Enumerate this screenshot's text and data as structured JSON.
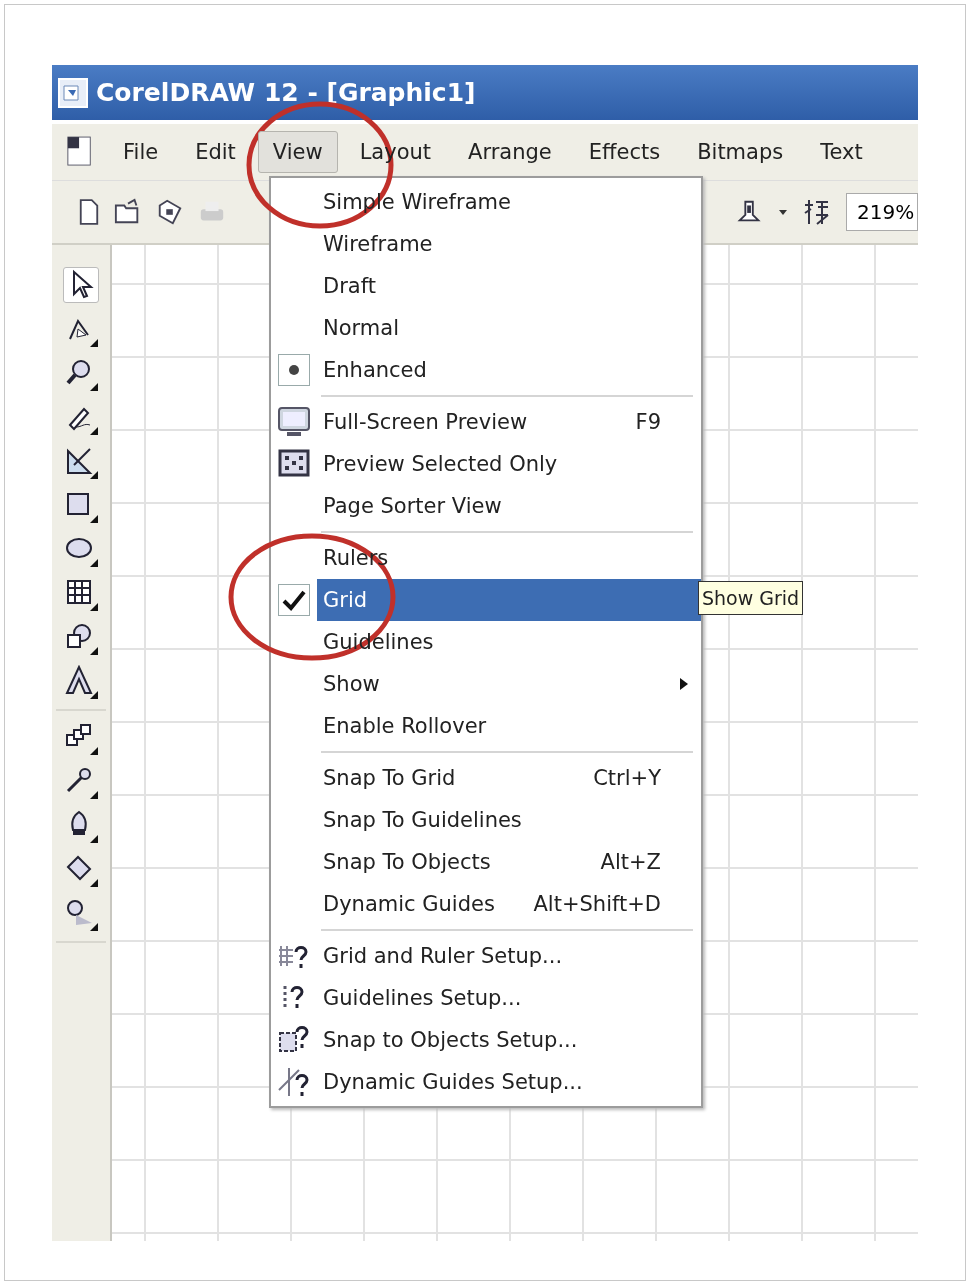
{
  "window": {
    "title": "CorelDRAW 12 - [Graphic1]"
  },
  "menu_bar": [
    {
      "label": "File",
      "selected": false
    },
    {
      "label": "Edit",
      "selected": false
    },
    {
      "label": "View",
      "selected": true
    },
    {
      "label": "Layout",
      "selected": false
    },
    {
      "label": "Arrange",
      "selected": false
    },
    {
      "label": "Effects",
      "selected": false
    },
    {
      "label": "Bitmaps",
      "selected": false
    },
    {
      "label": "Text",
      "selected": false
    }
  ],
  "toolbar": {
    "zoom": "219%"
  },
  "view_menu": [
    {
      "kind": "radio",
      "label": "Simple Wireframe",
      "checked": false,
      "selected": false
    },
    {
      "kind": "radio",
      "label": "Wireframe",
      "checked": false,
      "selected": false
    },
    {
      "kind": "radio",
      "label": "Draft",
      "checked": false,
      "selected": false
    },
    {
      "kind": "radio",
      "label": "Normal",
      "checked": false,
      "selected": false
    },
    {
      "kind": "radio",
      "label": "Enhanced",
      "checked": true,
      "selected": false
    },
    {
      "kind": "separator"
    },
    {
      "kind": "command",
      "label": "Full-Screen Preview",
      "shortcut": "F9",
      "selected": false
    },
    {
      "kind": "command",
      "label": "Preview Selected Only",
      "selected": false
    },
    {
      "kind": "command",
      "label": "Page Sorter View",
      "selected": false
    },
    {
      "kind": "separator"
    },
    {
      "kind": "check",
      "label": "Rulers",
      "checked": false,
      "selected": false
    },
    {
      "kind": "check",
      "label": "Grid",
      "checked": true,
      "selected": true
    },
    {
      "kind": "check",
      "label": "Guidelines",
      "checked": false,
      "selected": false
    },
    {
      "kind": "submenu",
      "label": "Show",
      "selected": false
    },
    {
      "kind": "check",
      "label": "Enable Rollover",
      "checked": false,
      "selected": false
    },
    {
      "kind": "separator"
    },
    {
      "kind": "check",
      "label": "Snap To Grid",
      "shortcut": "Ctrl+Y",
      "checked": false,
      "selected": false
    },
    {
      "kind": "check",
      "label": "Snap To Guidelines",
      "checked": false,
      "selected": false
    },
    {
      "kind": "check",
      "label": "Snap To Objects",
      "shortcut": "Alt+Z",
      "checked": false,
      "selected": false
    },
    {
      "kind": "check",
      "label": "Dynamic Guides",
      "shortcut": "Alt+Shift+D",
      "checked": false,
      "selected": false
    },
    {
      "kind": "separator"
    },
    {
      "kind": "command",
      "label": "Grid and Ruler Setup...",
      "selected": false
    },
    {
      "kind": "command",
      "label": "Guidelines Setup...",
      "selected": false
    },
    {
      "kind": "command",
      "label": "Snap to Objects Setup...",
      "selected": false
    },
    {
      "kind": "command",
      "label": "Dynamic Guides Setup...",
      "selected": false
    }
  ],
  "tooltip": "Show Grid"
}
